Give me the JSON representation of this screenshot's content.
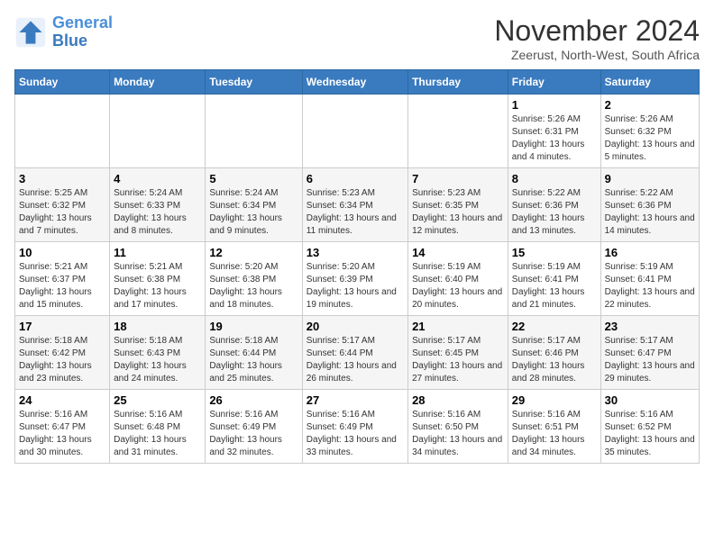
{
  "logo": {
    "line1": "General",
    "line2": "Blue"
  },
  "title": "November 2024",
  "location": "Zeerust, North-West, South Africa",
  "days_of_week": [
    "Sunday",
    "Monday",
    "Tuesday",
    "Wednesday",
    "Thursday",
    "Friday",
    "Saturday"
  ],
  "weeks": [
    [
      {
        "day": "",
        "info": ""
      },
      {
        "day": "",
        "info": ""
      },
      {
        "day": "",
        "info": ""
      },
      {
        "day": "",
        "info": ""
      },
      {
        "day": "",
        "info": ""
      },
      {
        "day": "1",
        "info": "Sunrise: 5:26 AM\nSunset: 6:31 PM\nDaylight: 13 hours and 4 minutes."
      },
      {
        "day": "2",
        "info": "Sunrise: 5:26 AM\nSunset: 6:32 PM\nDaylight: 13 hours and 5 minutes."
      }
    ],
    [
      {
        "day": "3",
        "info": "Sunrise: 5:25 AM\nSunset: 6:32 PM\nDaylight: 13 hours and 7 minutes."
      },
      {
        "day": "4",
        "info": "Sunrise: 5:24 AM\nSunset: 6:33 PM\nDaylight: 13 hours and 8 minutes."
      },
      {
        "day": "5",
        "info": "Sunrise: 5:24 AM\nSunset: 6:34 PM\nDaylight: 13 hours and 9 minutes."
      },
      {
        "day": "6",
        "info": "Sunrise: 5:23 AM\nSunset: 6:34 PM\nDaylight: 13 hours and 11 minutes."
      },
      {
        "day": "7",
        "info": "Sunrise: 5:23 AM\nSunset: 6:35 PM\nDaylight: 13 hours and 12 minutes."
      },
      {
        "day": "8",
        "info": "Sunrise: 5:22 AM\nSunset: 6:36 PM\nDaylight: 13 hours and 13 minutes."
      },
      {
        "day": "9",
        "info": "Sunrise: 5:22 AM\nSunset: 6:36 PM\nDaylight: 13 hours and 14 minutes."
      }
    ],
    [
      {
        "day": "10",
        "info": "Sunrise: 5:21 AM\nSunset: 6:37 PM\nDaylight: 13 hours and 15 minutes."
      },
      {
        "day": "11",
        "info": "Sunrise: 5:21 AM\nSunset: 6:38 PM\nDaylight: 13 hours and 17 minutes."
      },
      {
        "day": "12",
        "info": "Sunrise: 5:20 AM\nSunset: 6:38 PM\nDaylight: 13 hours and 18 minutes."
      },
      {
        "day": "13",
        "info": "Sunrise: 5:20 AM\nSunset: 6:39 PM\nDaylight: 13 hours and 19 minutes."
      },
      {
        "day": "14",
        "info": "Sunrise: 5:19 AM\nSunset: 6:40 PM\nDaylight: 13 hours and 20 minutes."
      },
      {
        "day": "15",
        "info": "Sunrise: 5:19 AM\nSunset: 6:41 PM\nDaylight: 13 hours and 21 minutes."
      },
      {
        "day": "16",
        "info": "Sunrise: 5:19 AM\nSunset: 6:41 PM\nDaylight: 13 hours and 22 minutes."
      }
    ],
    [
      {
        "day": "17",
        "info": "Sunrise: 5:18 AM\nSunset: 6:42 PM\nDaylight: 13 hours and 23 minutes."
      },
      {
        "day": "18",
        "info": "Sunrise: 5:18 AM\nSunset: 6:43 PM\nDaylight: 13 hours and 24 minutes."
      },
      {
        "day": "19",
        "info": "Sunrise: 5:18 AM\nSunset: 6:44 PM\nDaylight: 13 hours and 25 minutes."
      },
      {
        "day": "20",
        "info": "Sunrise: 5:17 AM\nSunset: 6:44 PM\nDaylight: 13 hours and 26 minutes."
      },
      {
        "day": "21",
        "info": "Sunrise: 5:17 AM\nSunset: 6:45 PM\nDaylight: 13 hours and 27 minutes."
      },
      {
        "day": "22",
        "info": "Sunrise: 5:17 AM\nSunset: 6:46 PM\nDaylight: 13 hours and 28 minutes."
      },
      {
        "day": "23",
        "info": "Sunrise: 5:17 AM\nSunset: 6:47 PM\nDaylight: 13 hours and 29 minutes."
      }
    ],
    [
      {
        "day": "24",
        "info": "Sunrise: 5:16 AM\nSunset: 6:47 PM\nDaylight: 13 hours and 30 minutes."
      },
      {
        "day": "25",
        "info": "Sunrise: 5:16 AM\nSunset: 6:48 PM\nDaylight: 13 hours and 31 minutes."
      },
      {
        "day": "26",
        "info": "Sunrise: 5:16 AM\nSunset: 6:49 PM\nDaylight: 13 hours and 32 minutes."
      },
      {
        "day": "27",
        "info": "Sunrise: 5:16 AM\nSunset: 6:49 PM\nDaylight: 13 hours and 33 minutes."
      },
      {
        "day": "28",
        "info": "Sunrise: 5:16 AM\nSunset: 6:50 PM\nDaylight: 13 hours and 34 minutes."
      },
      {
        "day": "29",
        "info": "Sunrise: 5:16 AM\nSunset: 6:51 PM\nDaylight: 13 hours and 34 minutes."
      },
      {
        "day": "30",
        "info": "Sunrise: 5:16 AM\nSunset: 6:52 PM\nDaylight: 13 hours and 35 minutes."
      }
    ]
  ]
}
